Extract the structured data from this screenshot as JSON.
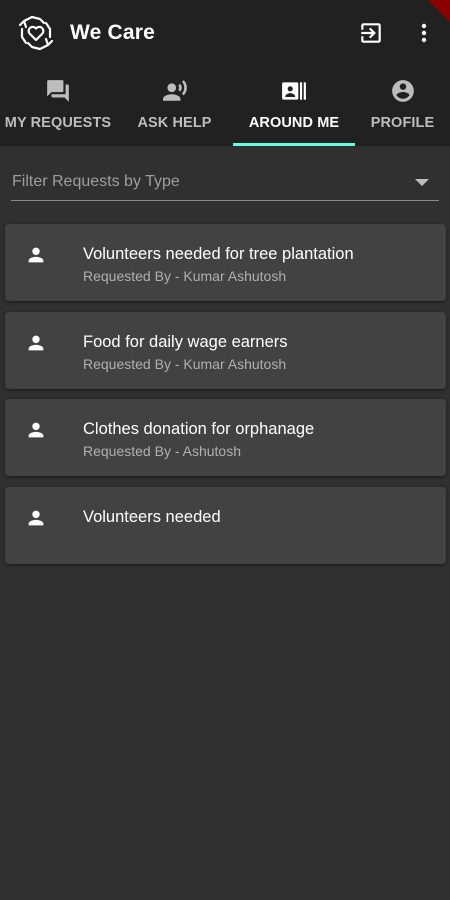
{
  "app": {
    "title": "We Care",
    "logo_icon": "hands-heart-icon",
    "actions": [
      {
        "name": "logout",
        "icon": "logout-icon"
      },
      {
        "name": "more",
        "icon": "more-vert-icon"
      }
    ]
  },
  "tabs": [
    {
      "label": "MY REQUESTS",
      "icon": "forum-icon",
      "active": false
    },
    {
      "label": "ASK HELP",
      "icon": "record-voice-icon",
      "active": false
    },
    {
      "label": "AROUND ME",
      "icon": "contact-card-icon",
      "active": true
    },
    {
      "label": "PROFILE",
      "icon": "account-circle-icon",
      "active": false
    }
  ],
  "filter": {
    "placeholder": "Filter Requests by Type"
  },
  "requests": [
    {
      "title": "Volunteers needed for tree plantation",
      "subtitle": "Requested By - Kumar Ashutosh",
      "icon": "person-icon"
    },
    {
      "title": "Food for daily wage earners",
      "subtitle": "Requested By - Kumar Ashutosh",
      "icon": "person-icon"
    },
    {
      "title": "Clothes donation for orphanage",
      "subtitle": "Requested By - Ashutosh",
      "icon": "person-icon"
    },
    {
      "title": "Volunteers needed",
      "subtitle": "",
      "icon": "person-icon"
    }
  ],
  "colors": {
    "appbar": "#212121",
    "background": "#303030",
    "card": "#424242",
    "tab_indicator": "#64ffda",
    "debug_banner": "#8b0000"
  }
}
